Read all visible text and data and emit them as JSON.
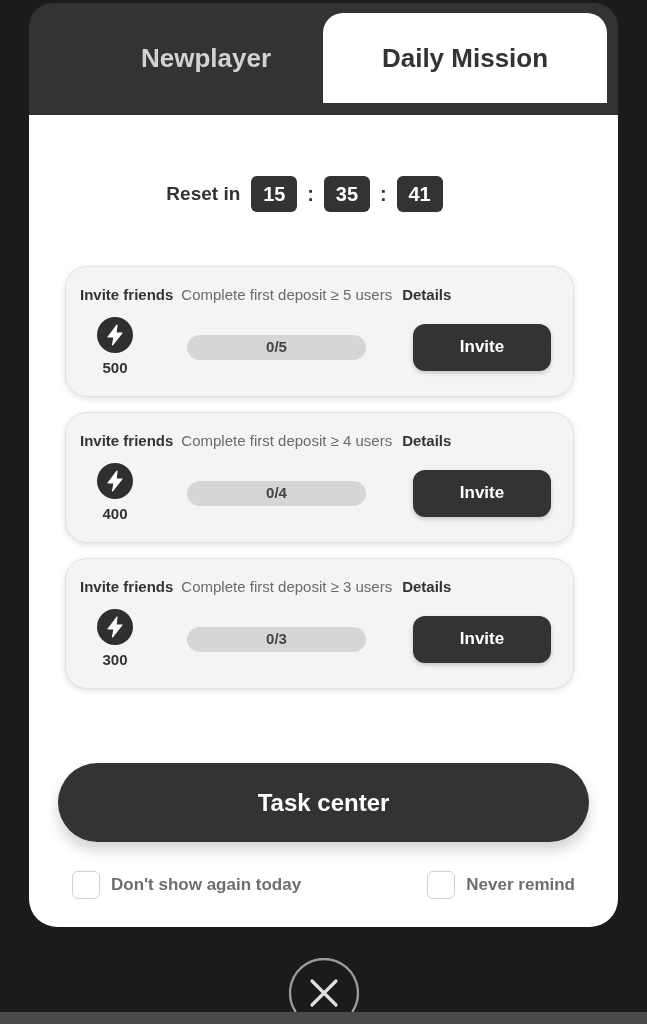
{
  "tabs": [
    {
      "label": "Newplayer",
      "selected": false
    },
    {
      "label": "Daily Mission",
      "selected": true
    }
  ],
  "timer": {
    "label": "Reset in",
    "units": [
      "15",
      "35",
      "41"
    ],
    "separators": [
      ":",
      ":"
    ]
  },
  "missions": [
    {
      "title": "Invite friends",
      "description": "Complete first deposit ≥ 5 users",
      "details": "Details",
      "reward": "500",
      "progress": "0/5",
      "button": "Invite"
    },
    {
      "title": "Invite friends",
      "description": "Complete first deposit ≥ 4 users",
      "details": "Details",
      "reward": "400",
      "progress": "0/4",
      "button": "Invite"
    },
    {
      "title": "Invite friends",
      "description": "Complete first deposit ≥ 3 users",
      "details": "Details",
      "reward": "300",
      "progress": "0/3",
      "button": "Invite"
    }
  ],
  "task_button": "Task center",
  "options": [
    {
      "label": "Don't show again today",
      "checked": false
    },
    {
      "label": "Never remind",
      "checked": false
    }
  ]
}
